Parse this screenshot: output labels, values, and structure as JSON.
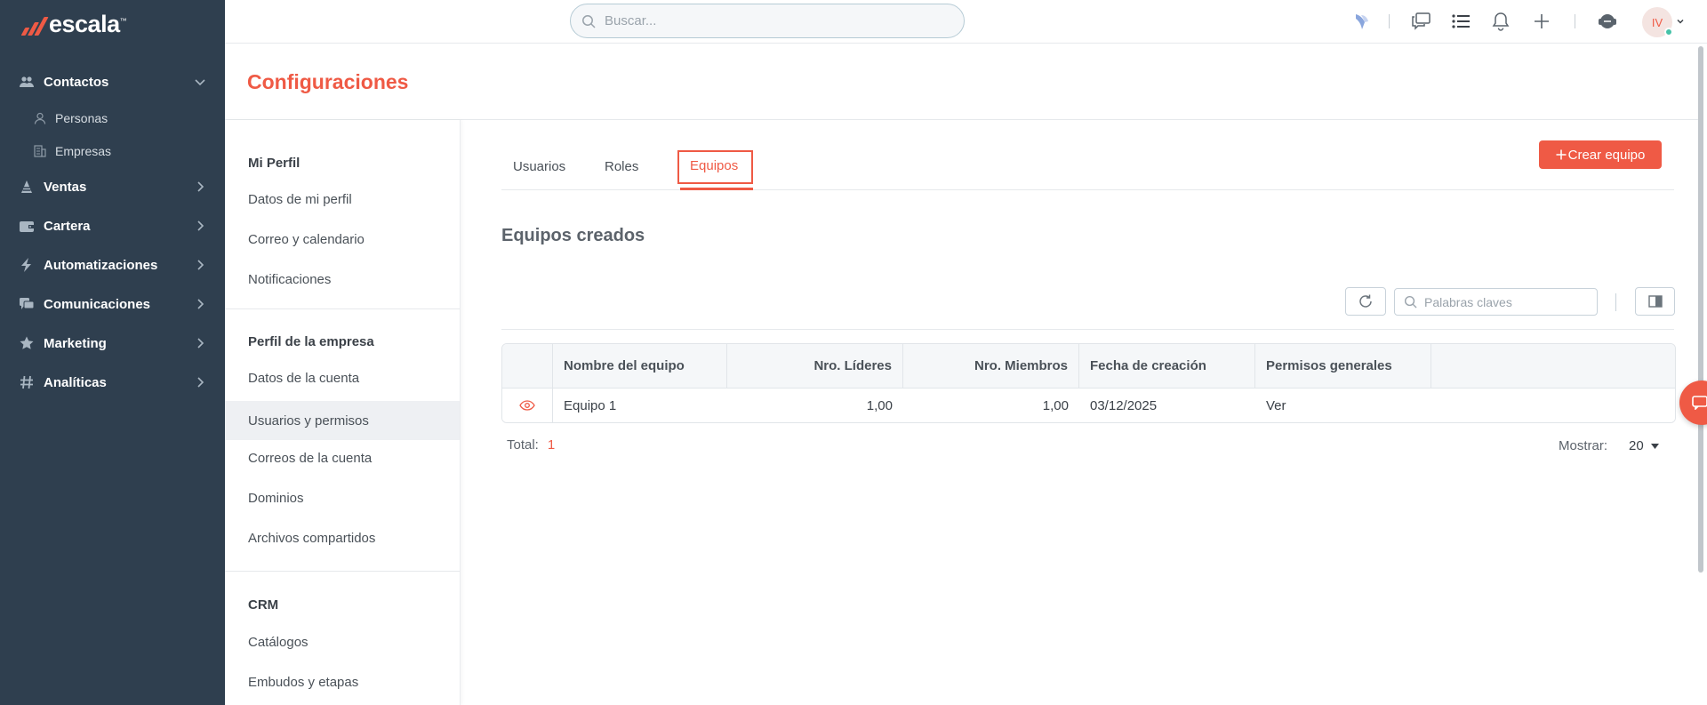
{
  "app": {
    "logo_text": "escala",
    "logo_tm": "™"
  },
  "sidebar": {
    "items": [
      {
        "label": "Contactos",
        "icon": "people-icon",
        "expanded": true
      },
      {
        "label": "Personas",
        "icon": "person-icon"
      },
      {
        "label": "Empresas",
        "icon": "building-icon"
      },
      {
        "label": "Ventas",
        "icon": "cone-icon"
      },
      {
        "label": "Cartera",
        "icon": "wallet-icon"
      },
      {
        "label": "Automatizaciones",
        "icon": "bolt-icon"
      },
      {
        "label": "Comunicaciones",
        "icon": "chat-icon"
      },
      {
        "label": "Marketing",
        "icon": "star-icon"
      },
      {
        "label": "Analíticas",
        "icon": "hash-icon"
      }
    ]
  },
  "topbar": {
    "search_placeholder": "Buscar...",
    "avatar_initials": "IV",
    "icons": [
      "bird-icon",
      "messages-icon",
      "list-icon",
      "bell-icon",
      "plus-icon",
      "support-icon"
    ]
  },
  "page": {
    "title": "Configuraciones"
  },
  "settings_menu": {
    "sections": [
      {
        "heading": "Mi Perfil",
        "links": [
          "Datos de mi perfil",
          "Correo y calendario",
          "Notificaciones"
        ]
      },
      {
        "heading": "Perfil de la empresa",
        "links": [
          "Datos de la cuenta",
          "Usuarios y permisos",
          "Correos de la cuenta",
          "Dominios",
          "Archivos compartidos"
        ]
      },
      {
        "heading": "CRM",
        "links": [
          "Catálogos",
          "Embudos y etapas"
        ]
      }
    ],
    "active_link": "Usuarios y permisos"
  },
  "tabs": [
    {
      "label": "Usuarios"
    },
    {
      "label": "Roles"
    },
    {
      "label": "Equipos",
      "active": true
    }
  ],
  "create_button": {
    "label": "Crear equipo"
  },
  "section_title": "Equipos creados",
  "keyword_search": {
    "placeholder": "Palabras claves"
  },
  "table": {
    "headers": [
      "Nombre del equipo",
      "Nro. Líderes",
      "Nro. Miembros",
      "Fecha de creación",
      "Permisos generales"
    ],
    "rows": [
      {
        "name": "Equipo 1",
        "leaders": "1,00",
        "members": "1,00",
        "created": "03/12/2025",
        "permissions": "Ver"
      }
    ]
  },
  "footer": {
    "total_label": "Total:",
    "total_value": "1",
    "show_label": "Mostrar:",
    "show_value": "20"
  },
  "colors": {
    "accent": "#ef5a45",
    "sidebar_bg": "#2f3f4f"
  }
}
